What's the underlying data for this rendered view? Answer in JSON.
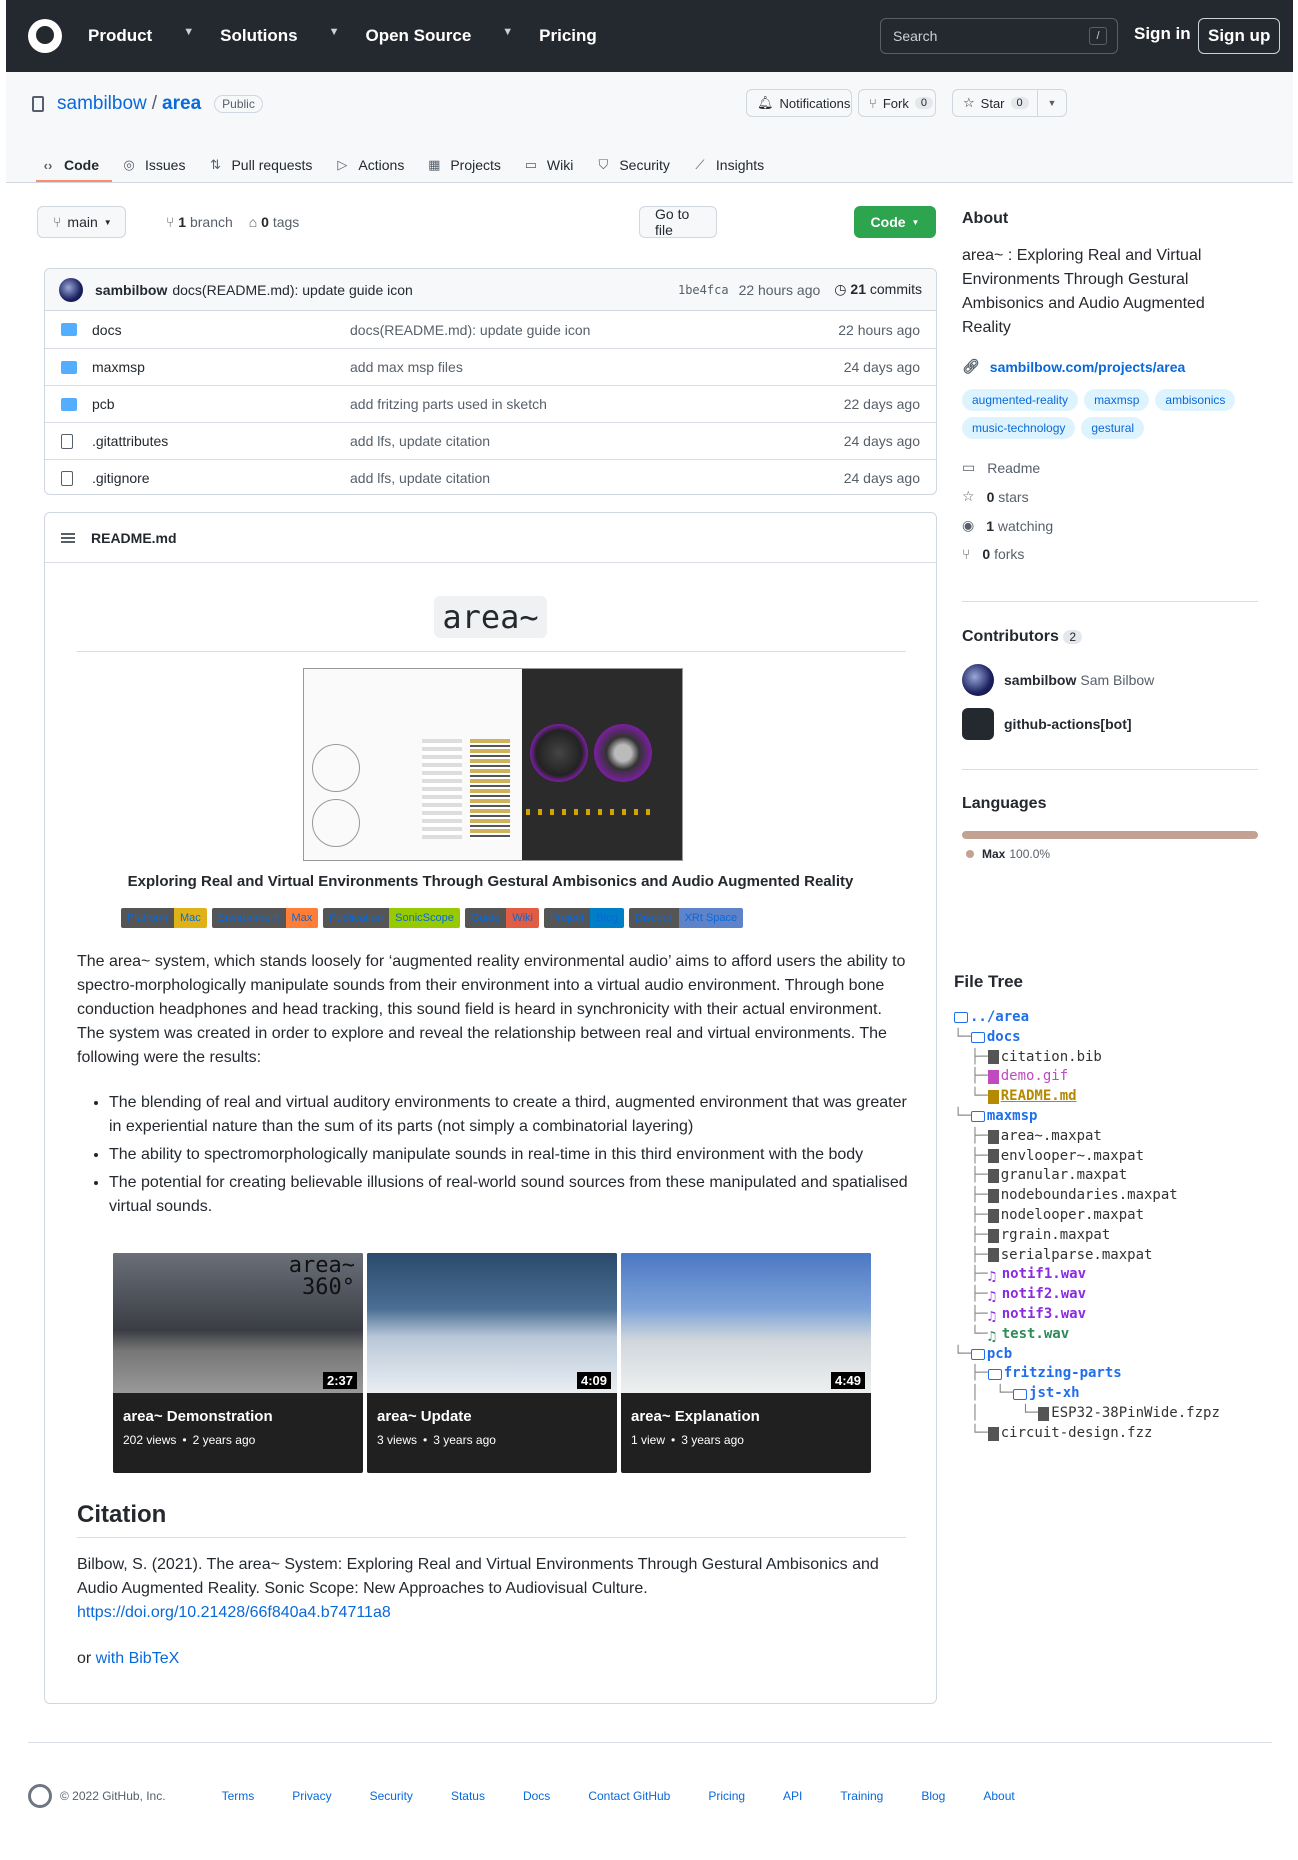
{
  "header": {
    "nav": [
      "Product",
      "Solutions",
      "Open Source",
      "Pricing"
    ],
    "nav_has_chevron": [
      true,
      true,
      true,
      false
    ],
    "search_placeholder": "Search",
    "search_key": "/",
    "signin": "Sign in",
    "signup": "Sign up"
  },
  "repo": {
    "owner": "sambilbow",
    "sep": "/",
    "name": "area",
    "visibility": "Public",
    "notifications": "Notifications",
    "fork_label": "Fork",
    "fork_count": "0",
    "star_label": "Star",
    "star_count": "0"
  },
  "tabs": [
    {
      "label": "Code",
      "icon": "code-icon"
    },
    {
      "label": "Issues",
      "icon": "issue-icon"
    },
    {
      "label": "Pull requests",
      "icon": "pull-request-icon"
    },
    {
      "label": "Actions",
      "icon": "play-icon"
    },
    {
      "label": "Projects",
      "icon": "table-icon"
    },
    {
      "label": "Wiki",
      "icon": "book-icon"
    },
    {
      "label": "Security",
      "icon": "shield-icon"
    },
    {
      "label": "Insights",
      "icon": "graph-icon"
    }
  ],
  "toolbar": {
    "branch": "main",
    "branch_count": "1",
    "branch_word": "branch",
    "tag_count": "0",
    "tag_word": "tags",
    "goto": "Go to file",
    "code": "Code"
  },
  "commit": {
    "user": "sambilbow",
    "message": "docs(README.md): update guide icon",
    "sha": "1be4fca",
    "time": "22 hours ago",
    "count": "21",
    "count_word": "commits"
  },
  "files": [
    {
      "type": "dir",
      "name": "docs",
      "msg": "docs(README.md): update guide icon",
      "date": "22 hours ago"
    },
    {
      "type": "dir",
      "name": "maxmsp",
      "msg": "add max msp files",
      "date": "24 days ago"
    },
    {
      "type": "dir",
      "name": "pcb",
      "msg": "add fritzing parts used in sketch",
      "date": "22 days ago"
    },
    {
      "type": "file",
      "name": ".gitattributes",
      "msg": "add lfs, update citation",
      "date": "24 days ago"
    },
    {
      "type": "file",
      "name": ".gitignore",
      "msg": "add lfs, update citation",
      "date": "24 days ago"
    }
  ],
  "readme": {
    "filename": "README.md",
    "title": "area~",
    "subtitle": "Exploring Real and Virtual Environments Through Gestural Ambisonics and Audio Augmented Reality",
    "badges": [
      {
        "a": "Platform",
        "b": "Mac",
        "color": "#dfb317"
      },
      {
        "a": "Environment",
        "b": "Max",
        "color": "#fe7d37"
      },
      {
        "a": "Publication",
        "b": "SonicScope",
        "color": "#97ca00"
      },
      {
        "a": "Guide",
        "b": "Wiki",
        "color": "#e05d44"
      },
      {
        "a": "Project",
        "b": "Blog",
        "color": "#007ec6"
      },
      {
        "a": "Discord",
        "b": "XRt Space",
        "color": "#5f83c9"
      }
    ],
    "intro": "The area~ system, which stands loosely for ‘augmented reality environmental audio’ aims to afford users the ability to spectro-morphologically manipulate sounds from their environment into a virtual audio environment. Through bone conduction headphones and head tracking, this sound field is heard in synchronicity with their actual environment. The system was created in order to explore and reveal the relationship between real and virtual environments. The following were the results:",
    "bullets": [
      "The blending of real and virtual auditory environments to create a third, augmented environment that was greater in experiential nature than the sum of its parts (not simply a combinatorial layering)",
      "The ability to spectromorphologically manipulate sounds in real-time in this third environment with the body",
      "The potential for creating believable illusions of real-world sound sources from these manipulated and spatialised virtual sounds."
    ],
    "videos": [
      {
        "title": "area~ Demonstration",
        "views": "202 views",
        "age": "2 years ago",
        "duration": "2:37",
        "overlay1": "area~",
        "overlay2": "360°"
      },
      {
        "title": "area~ Update",
        "views": "3 views",
        "age": "3 years ago",
        "duration": "4:09"
      },
      {
        "title": "area~ Explanation",
        "views": "1 view",
        "age": "3 years ago",
        "duration": "4:49"
      }
    ],
    "meta_dot": "•",
    "citation_heading": "Citation",
    "citation_text": "Bilbow, S. (2021). The area~ System: Exploring Real and Virtual Environments Through Gestural Ambisonics and Audio Augmented Reality. Sonic Scope: New Approaches to Audiovisual Culture.",
    "citation_doi": "https://doi.org/10.21428/66f840a4.b74711a8",
    "bibtex_prefix": "or ",
    "bibtex_link": "with BibTeX"
  },
  "about": {
    "heading": "About",
    "description": "area~ : Exploring Real and Virtual Environments Through Gestural Ambisonics and Audio Augmented Reality",
    "link": "sambilbow.com/projects/area",
    "topics": [
      "augmented-reality",
      "maxmsp",
      "ambisonics",
      "music-technology",
      "gestural"
    ],
    "readme": "Readme",
    "stars_n": "0",
    "stars": "stars",
    "watching_n": "1",
    "watching": "watching",
    "forks_n": "0",
    "forks": "forks"
  },
  "contributors": {
    "heading": "Contributors",
    "count": "2",
    "list": [
      {
        "login": "sambilbow",
        "name": "Sam Bilbow"
      },
      {
        "login": "github-actions[bot]",
        "name": ""
      }
    ]
  },
  "languages": {
    "heading": "Languages",
    "name": "Max",
    "pct": "100.0%",
    "fraction": 1.0
  },
  "filetree": {
    "heading": "File Tree",
    "rows": [
      {
        "g": "",
        "n": "../area",
        "k": "dir"
      },
      {
        "g": "└─",
        "n": "docs",
        "k": "dir"
      },
      {
        "g": "  ├─",
        "n": "citation.bib",
        "k": "file"
      },
      {
        "g": "  ├─",
        "n": "demo.gif",
        "k": "gif"
      },
      {
        "g": "  └─",
        "n": "README.md",
        "k": "md"
      },
      {
        "g": "└─",
        "n": "maxmsp",
        "k": "dir"
      },
      {
        "g": "  ├─",
        "n": "area~.maxpat",
        "k": "file"
      },
      {
        "g": "  ├─",
        "n": "envlooper~.maxpat",
        "k": "file"
      },
      {
        "g": "  ├─",
        "n": "granular.maxpat",
        "k": "file"
      },
      {
        "g": "  ├─",
        "n": "nodeboundaries.maxpat",
        "k": "file"
      },
      {
        "g": "  ├─",
        "n": "nodelooper.maxpat",
        "k": "file"
      },
      {
        "g": "  ├─",
        "n": "rgrain.maxpat",
        "k": "file"
      },
      {
        "g": "  ├─",
        "n": "serialparse.maxpat",
        "k": "file"
      },
      {
        "g": "  ├─",
        "n": "notif1.wav",
        "k": "wav"
      },
      {
        "g": "  ├─",
        "n": "notif2.wav",
        "k": "wav"
      },
      {
        "g": "  ├─",
        "n": "notif3.wav",
        "k": "wav"
      },
      {
        "g": "  └─",
        "n": "test.wav",
        "k": "wav2"
      },
      {
        "g": "└─",
        "n": "pcb",
        "k": "dir"
      },
      {
        "g": "  ├─",
        "n": "fritzing-parts",
        "k": "dir"
      },
      {
        "g": "  │  └─",
        "n": "jst-xh",
        "k": "dir"
      },
      {
        "g": "  │     └─",
        "n": "ESP32-38PinWide.fzpz",
        "k": "file"
      },
      {
        "g": "  └─",
        "n": "circuit-design.fzz",
        "k": "file"
      }
    ]
  },
  "footer": {
    "copyright": "© 2022 GitHub, Inc.",
    "links": [
      "Terms",
      "Privacy",
      "Security",
      "Status",
      "Docs",
      "Contact GitHub",
      "Pricing",
      "API",
      "Training",
      "Blog",
      "About"
    ]
  }
}
